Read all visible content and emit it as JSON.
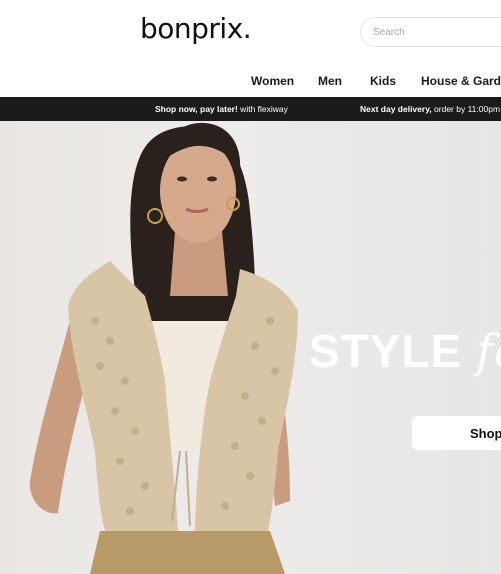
{
  "header": {
    "logo_text": "bonprix.",
    "search_placeholder": "Search"
  },
  "nav": {
    "items": [
      {
        "label": "Women"
      },
      {
        "label": "Men"
      },
      {
        "label": "Kids"
      },
      {
        "label": "House & Garden"
      }
    ]
  },
  "promo": {
    "items": [
      {
        "bold": "Shop now, pay later!",
        "rest": " with flexiway"
      },
      {
        "bold": "Next day delivery,",
        "rest": " order by 11:00pm"
      }
    ]
  },
  "hero": {
    "headline_bold": "STYLE ",
    "headline_script": "fo",
    "cta_label": "Shop",
    "model_image_icon": "model-photo"
  },
  "colors": {
    "promo_bar": "#1b1b1b",
    "hero_background": "#eceae8",
    "cardigan": "#d7c5a5"
  }
}
